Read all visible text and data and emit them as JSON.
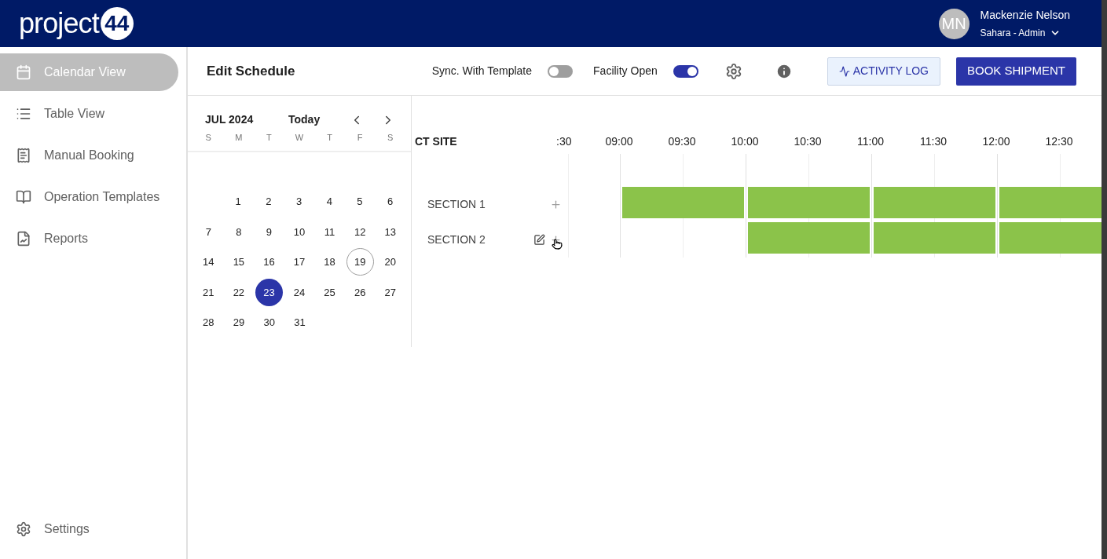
{
  "header": {
    "logo": {
      "word": "project",
      "badge": "44"
    },
    "user": {
      "initials": "MN",
      "name": "Mackenzie Nelson",
      "role": "Sahara - Admin"
    }
  },
  "sidebar": {
    "items": [
      {
        "label": "Calendar View",
        "selected": true
      },
      {
        "label": "Table View",
        "selected": false
      },
      {
        "label": "Manual Booking",
        "selected": false
      },
      {
        "label": "Operation Templates",
        "selected": false
      },
      {
        "label": "Reports",
        "selected": false
      }
    ],
    "footer": {
      "label": "Settings"
    }
  },
  "toolbar": {
    "title": "Edit Schedule",
    "toggles": [
      {
        "label": "Sync. With Template",
        "on": false
      },
      {
        "label": "Facility Open",
        "on": true
      }
    ],
    "activity_button": "ACTIVITY LOG",
    "book_button": "BOOK SHIPMENT"
  },
  "calendar": {
    "month": "JUL 2024",
    "today_button": "Today",
    "weekdays": [
      "S",
      "M",
      "T",
      "W",
      "T",
      "F",
      "S"
    ],
    "weeks": [
      {
        "kind": "first",
        "days": [
          {
            "label": "1",
            "selected": false,
            "today": false
          },
          {
            "label": "2",
            "selected": false,
            "today": false
          },
          {
            "label": "3",
            "selected": false,
            "today": false
          },
          {
            "label": "4",
            "selected": false,
            "today": false
          },
          {
            "label": "5",
            "selected": false,
            "today": false
          },
          {
            "label": "6",
            "selected": false,
            "today": false
          }
        ]
      },
      {
        "kind": "full",
        "days": [
          {
            "label": "7",
            "selected": false,
            "today": false
          },
          {
            "label": "8",
            "selected": false,
            "today": false
          },
          {
            "label": "9",
            "selected": false,
            "today": false
          },
          {
            "label": "10",
            "selected": false,
            "today": false
          },
          {
            "label": "11",
            "selected": false,
            "today": false
          },
          {
            "label": "12",
            "selected": false,
            "today": false
          },
          {
            "label": "13",
            "selected": false,
            "today": false
          }
        ]
      },
      {
        "kind": "full",
        "days": [
          {
            "label": "14",
            "selected": false,
            "today": false
          },
          {
            "label": "15",
            "selected": false,
            "today": false
          },
          {
            "label": "16",
            "selected": false,
            "today": false
          },
          {
            "label": "17",
            "selected": false,
            "today": false
          },
          {
            "label": "18",
            "selected": false,
            "today": false
          },
          {
            "label": "19",
            "selected": false,
            "today": true
          },
          {
            "label": "20",
            "selected": false,
            "today": false
          }
        ]
      },
      {
        "kind": "full",
        "days": [
          {
            "label": "21",
            "selected": false,
            "today": false
          },
          {
            "label": "22",
            "selected": false,
            "today": false
          },
          {
            "label": "23",
            "selected": true,
            "today": false
          },
          {
            "label": "24",
            "selected": false,
            "today": false
          },
          {
            "label": "25",
            "selected": false,
            "today": false
          },
          {
            "label": "26",
            "selected": false,
            "today": false
          },
          {
            "label": "27",
            "selected": false,
            "today": false
          }
        ]
      },
      {
        "kind": "last",
        "days": [
          {
            "label": "28",
            "selected": false,
            "today": false
          },
          {
            "label": "29",
            "selected": false,
            "today": false
          },
          {
            "label": "30",
            "selected": false,
            "today": false
          },
          {
            "label": "31",
            "selected": false,
            "today": false
          }
        ]
      }
    ]
  },
  "schedule": {
    "site": "CT SITE",
    "times": [
      ":30",
      "09:00",
      "09:30",
      "10:00",
      "10:30",
      "11:00",
      "11:30",
      "12:00",
      "12:30"
    ],
    "sections": [
      {
        "label": "SECTION 1",
        "hovered": false,
        "slots": [
          true,
          true,
          true,
          true
        ]
      },
      {
        "label": "SECTION 2",
        "hovered": true,
        "slots": [
          false,
          true,
          true,
          true
        ]
      }
    ]
  }
}
